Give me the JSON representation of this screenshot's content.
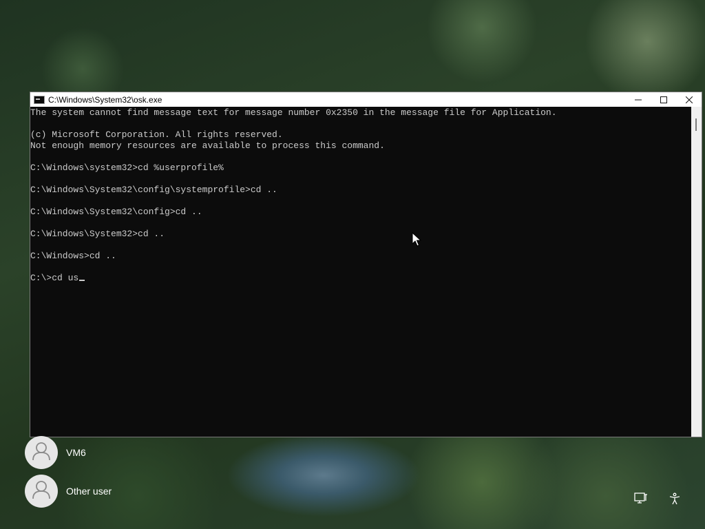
{
  "window": {
    "title": "C:\\Windows\\System32\\osk.exe",
    "controls": {
      "minimize_icon": "minimize-icon",
      "maximize_icon": "maximize-icon",
      "close_icon": "close-icon"
    }
  },
  "console": {
    "lines": [
      "The system cannot find message text for message number 0x2350 in the message file for Application.",
      "",
      "(c) Microsoft Corporation. All rights reserved.",
      "Not enough memory resources are available to process this command.",
      "",
      "C:\\Windows\\system32>cd %userprofile%",
      "",
      "C:\\Windows\\System32\\config\\systemprofile>cd ..",
      "",
      "C:\\Windows\\System32\\config>cd ..",
      "",
      "C:\\Windows\\System32>cd ..",
      "",
      "C:\\Windows>cd ..",
      ""
    ],
    "current_input": "C:\\>cd us"
  },
  "users": [
    {
      "name": "VM6",
      "icon": "user-avatar-icon"
    },
    {
      "name": "Other user",
      "icon": "user-avatar-icon"
    }
  ],
  "tray": {
    "network_icon": "network-icon",
    "accessibility_icon": "accessibility-icon"
  },
  "colors": {
    "console_background": "#0c0c0c",
    "console_text": "#cccccc",
    "titlebar": "#ffffff"
  }
}
